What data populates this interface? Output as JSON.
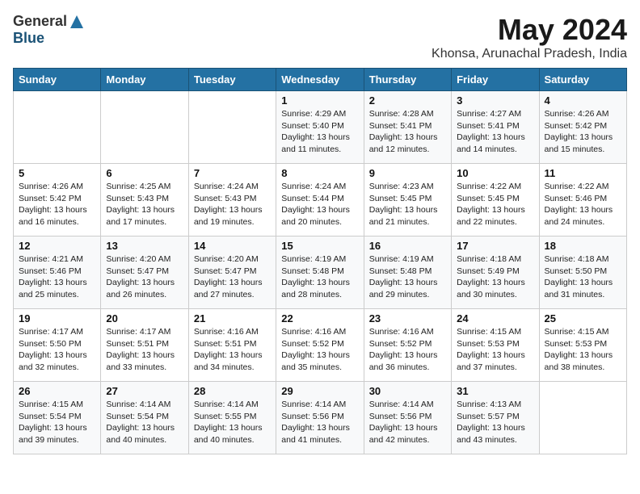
{
  "logo": {
    "general": "General",
    "blue": "Blue"
  },
  "title": "May 2024",
  "location": "Khonsa, Arunachal Pradesh, India",
  "headers": [
    "Sunday",
    "Monday",
    "Tuesday",
    "Wednesday",
    "Thursday",
    "Friday",
    "Saturday"
  ],
  "weeks": [
    [
      {
        "day": "",
        "info": ""
      },
      {
        "day": "",
        "info": ""
      },
      {
        "day": "",
        "info": ""
      },
      {
        "day": "1",
        "info": "Sunrise: 4:29 AM\nSunset: 5:40 PM\nDaylight: 13 hours\nand 11 minutes."
      },
      {
        "day": "2",
        "info": "Sunrise: 4:28 AM\nSunset: 5:41 PM\nDaylight: 13 hours\nand 12 minutes."
      },
      {
        "day": "3",
        "info": "Sunrise: 4:27 AM\nSunset: 5:41 PM\nDaylight: 13 hours\nand 14 minutes."
      },
      {
        "day": "4",
        "info": "Sunrise: 4:26 AM\nSunset: 5:42 PM\nDaylight: 13 hours\nand 15 minutes."
      }
    ],
    [
      {
        "day": "5",
        "info": "Sunrise: 4:26 AM\nSunset: 5:42 PM\nDaylight: 13 hours\nand 16 minutes."
      },
      {
        "day": "6",
        "info": "Sunrise: 4:25 AM\nSunset: 5:43 PM\nDaylight: 13 hours\nand 17 minutes."
      },
      {
        "day": "7",
        "info": "Sunrise: 4:24 AM\nSunset: 5:43 PM\nDaylight: 13 hours\nand 19 minutes."
      },
      {
        "day": "8",
        "info": "Sunrise: 4:24 AM\nSunset: 5:44 PM\nDaylight: 13 hours\nand 20 minutes."
      },
      {
        "day": "9",
        "info": "Sunrise: 4:23 AM\nSunset: 5:45 PM\nDaylight: 13 hours\nand 21 minutes."
      },
      {
        "day": "10",
        "info": "Sunrise: 4:22 AM\nSunset: 5:45 PM\nDaylight: 13 hours\nand 22 minutes."
      },
      {
        "day": "11",
        "info": "Sunrise: 4:22 AM\nSunset: 5:46 PM\nDaylight: 13 hours\nand 24 minutes."
      }
    ],
    [
      {
        "day": "12",
        "info": "Sunrise: 4:21 AM\nSunset: 5:46 PM\nDaylight: 13 hours\nand 25 minutes."
      },
      {
        "day": "13",
        "info": "Sunrise: 4:20 AM\nSunset: 5:47 PM\nDaylight: 13 hours\nand 26 minutes."
      },
      {
        "day": "14",
        "info": "Sunrise: 4:20 AM\nSunset: 5:47 PM\nDaylight: 13 hours\nand 27 minutes."
      },
      {
        "day": "15",
        "info": "Sunrise: 4:19 AM\nSunset: 5:48 PM\nDaylight: 13 hours\nand 28 minutes."
      },
      {
        "day": "16",
        "info": "Sunrise: 4:19 AM\nSunset: 5:48 PM\nDaylight: 13 hours\nand 29 minutes."
      },
      {
        "day": "17",
        "info": "Sunrise: 4:18 AM\nSunset: 5:49 PM\nDaylight: 13 hours\nand 30 minutes."
      },
      {
        "day": "18",
        "info": "Sunrise: 4:18 AM\nSunset: 5:50 PM\nDaylight: 13 hours\nand 31 minutes."
      }
    ],
    [
      {
        "day": "19",
        "info": "Sunrise: 4:17 AM\nSunset: 5:50 PM\nDaylight: 13 hours\nand 32 minutes."
      },
      {
        "day": "20",
        "info": "Sunrise: 4:17 AM\nSunset: 5:51 PM\nDaylight: 13 hours\nand 33 minutes."
      },
      {
        "day": "21",
        "info": "Sunrise: 4:16 AM\nSunset: 5:51 PM\nDaylight: 13 hours\nand 34 minutes."
      },
      {
        "day": "22",
        "info": "Sunrise: 4:16 AM\nSunset: 5:52 PM\nDaylight: 13 hours\nand 35 minutes."
      },
      {
        "day": "23",
        "info": "Sunrise: 4:16 AM\nSunset: 5:52 PM\nDaylight: 13 hours\nand 36 minutes."
      },
      {
        "day": "24",
        "info": "Sunrise: 4:15 AM\nSunset: 5:53 PM\nDaylight: 13 hours\nand 37 minutes."
      },
      {
        "day": "25",
        "info": "Sunrise: 4:15 AM\nSunset: 5:53 PM\nDaylight: 13 hours\nand 38 minutes."
      }
    ],
    [
      {
        "day": "26",
        "info": "Sunrise: 4:15 AM\nSunset: 5:54 PM\nDaylight: 13 hours\nand 39 minutes."
      },
      {
        "day": "27",
        "info": "Sunrise: 4:14 AM\nSunset: 5:54 PM\nDaylight: 13 hours\nand 40 minutes."
      },
      {
        "day": "28",
        "info": "Sunrise: 4:14 AM\nSunset: 5:55 PM\nDaylight: 13 hours\nand 40 minutes."
      },
      {
        "day": "29",
        "info": "Sunrise: 4:14 AM\nSunset: 5:56 PM\nDaylight: 13 hours\nand 41 minutes."
      },
      {
        "day": "30",
        "info": "Sunrise: 4:14 AM\nSunset: 5:56 PM\nDaylight: 13 hours\nand 42 minutes."
      },
      {
        "day": "31",
        "info": "Sunrise: 4:13 AM\nSunset: 5:57 PM\nDaylight: 13 hours\nand 43 minutes."
      },
      {
        "day": "",
        "info": ""
      }
    ]
  ]
}
